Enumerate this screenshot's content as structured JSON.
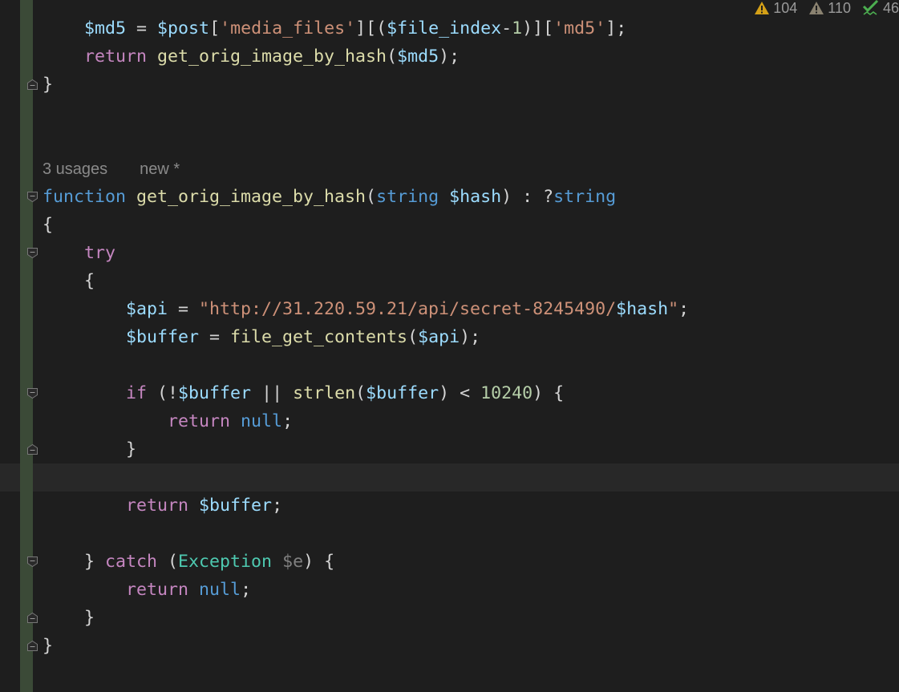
{
  "status": {
    "warnings": "104",
    "weak_warnings": "110",
    "ok": "46",
    "colors": {
      "warning": "#d4a017",
      "weak": "#8a8270",
      "ok": "#4caf50"
    }
  },
  "inlay": {
    "usages": "3 usages",
    "author": "new *"
  },
  "code": {
    "lines": [
      {
        "row": 0,
        "tokens": [
          {
            "t": "    "
          },
          {
            "t": "$md5",
            "c": "v"
          },
          {
            "t": " = "
          },
          {
            "t": "$post",
            "c": "v"
          },
          {
            "t": "["
          },
          {
            "t": "'media_files'",
            "c": "s"
          },
          {
            "t": "][("
          },
          {
            "t": "$file_index",
            "c": "v"
          },
          {
            "t": "-"
          },
          {
            "t": "1",
            "c": "n"
          },
          {
            "t": ")]["
          },
          {
            "t": "'md5'",
            "c": "s"
          },
          {
            "t": "];"
          }
        ]
      },
      {
        "row": 1,
        "tokens": [
          {
            "t": "    "
          },
          {
            "t": "return",
            "c": "k"
          },
          {
            "t": " "
          },
          {
            "t": "get_orig_image_by_hash",
            "c": "f"
          },
          {
            "t": "("
          },
          {
            "t": "$md5",
            "c": "v"
          },
          {
            "t": ");"
          }
        ]
      },
      {
        "row": 2,
        "tokens": [
          {
            "t": "}"
          }
        ]
      },
      {
        "row": 6,
        "tokens": [
          {
            "t": "function",
            "c": "kw"
          },
          {
            "t": " "
          },
          {
            "t": "get_orig_image_by_hash",
            "c": "f"
          },
          {
            "t": "("
          },
          {
            "t": "string",
            "c": "kw"
          },
          {
            "t": " "
          },
          {
            "t": "$hash",
            "c": "v"
          },
          {
            "t": ") : ?"
          },
          {
            "t": "string",
            "c": "kw"
          }
        ]
      },
      {
        "row": 7,
        "tokens": [
          {
            "t": "{"
          }
        ]
      },
      {
        "row": 8,
        "tokens": [
          {
            "t": "    "
          },
          {
            "t": "try",
            "c": "k"
          }
        ]
      },
      {
        "row": 9,
        "tokens": [
          {
            "t": "    {"
          }
        ]
      },
      {
        "row": 10,
        "tokens": [
          {
            "t": "        "
          },
          {
            "t": "$api",
            "c": "v"
          },
          {
            "t": " = "
          },
          {
            "t": "\"http://31.220.59.21/api/secret-8245490/",
            "c": "s"
          },
          {
            "t": "$hash",
            "c": "v"
          },
          {
            "t": "\"",
            "c": "s"
          },
          {
            "t": ";"
          }
        ]
      },
      {
        "row": 11,
        "tokens": [
          {
            "t": "        "
          },
          {
            "t": "$buffer",
            "c": "v"
          },
          {
            "t": " = "
          },
          {
            "t": "file_get_contents",
            "c": "f"
          },
          {
            "t": "("
          },
          {
            "t": "$api",
            "c": "v"
          },
          {
            "t": ");"
          }
        ]
      },
      {
        "row": 13,
        "tokens": [
          {
            "t": "        "
          },
          {
            "t": "if",
            "c": "k"
          },
          {
            "t": " (!"
          },
          {
            "t": "$buffer",
            "c": "v"
          },
          {
            "t": " || "
          },
          {
            "t": "strlen",
            "c": "f"
          },
          {
            "t": "("
          },
          {
            "t": "$buffer",
            "c": "v"
          },
          {
            "t": ") < "
          },
          {
            "t": "10240",
            "c": "n"
          },
          {
            "t": ") {"
          }
        ]
      },
      {
        "row": 14,
        "tokens": [
          {
            "t": "            "
          },
          {
            "t": "return",
            "c": "k"
          },
          {
            "t": " "
          },
          {
            "t": "null",
            "c": "kw"
          },
          {
            "t": ";"
          }
        ]
      },
      {
        "row": 15,
        "tokens": [
          {
            "t": "        }"
          }
        ]
      },
      {
        "row": 17,
        "tokens": [
          {
            "t": "        "
          },
          {
            "t": "return",
            "c": "k"
          },
          {
            "t": " "
          },
          {
            "t": "$buffer",
            "c": "v"
          },
          {
            "t": ";"
          }
        ]
      },
      {
        "row": 19,
        "tokens": [
          {
            "t": "    } "
          },
          {
            "t": "catch",
            "c": "k"
          },
          {
            "t": " ("
          },
          {
            "t": "Exception",
            "c": "cl"
          },
          {
            "t": " "
          },
          {
            "t": "$e",
            "c": "u"
          },
          {
            "t": ") {"
          }
        ]
      },
      {
        "row": 20,
        "tokens": [
          {
            "t": "        "
          },
          {
            "t": "return",
            "c": "k"
          },
          {
            "t": " "
          },
          {
            "t": "null",
            "c": "kw"
          },
          {
            "t": ";"
          }
        ]
      },
      {
        "row": 21,
        "tokens": [
          {
            "t": "    }"
          }
        ]
      },
      {
        "row": 22,
        "tokens": [
          {
            "t": "}"
          }
        ]
      }
    ],
    "fold_start_rows": [
      6,
      8,
      13,
      19
    ],
    "fold_end_rows": [
      2,
      15,
      21,
      22
    ]
  }
}
